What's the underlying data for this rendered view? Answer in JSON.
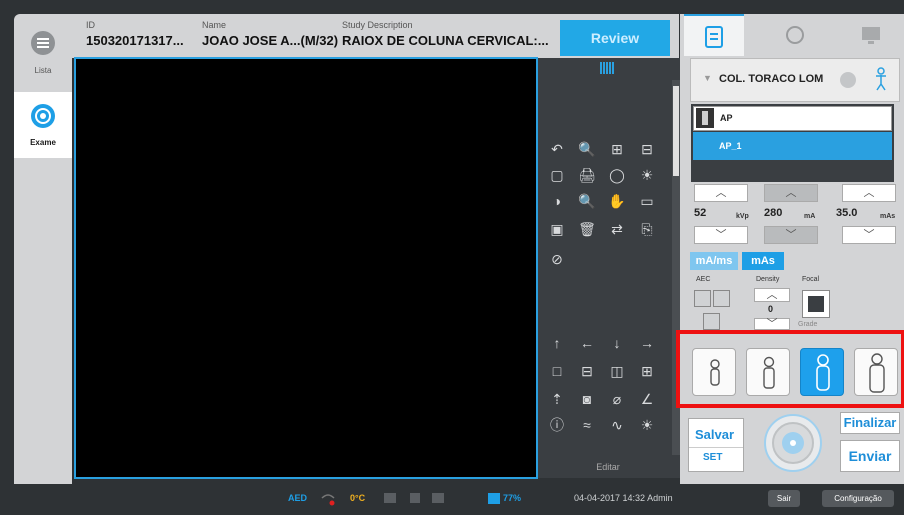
{
  "nav": {
    "items": [
      {
        "label": "Lista",
        "icon": "list-icon"
      },
      {
        "label": "Exame",
        "icon": "target-icon"
      }
    ]
  },
  "header": {
    "id_label": "ID",
    "id_value": "150320171317...",
    "name_label": "Name",
    "name_value": "JOAO JOSE A...(M/32)",
    "study_label": "Study Description",
    "study_value": "RAIOX DE COLUNA CERVICAL:...",
    "review_label": "Review"
  },
  "tools": {
    "edit_label": "Editar",
    "glyphs": [
      "↶",
      "🔍",
      "⊞",
      "⊟",
      "▢",
      "🖨",
      "◯",
      "☀",
      "◑",
      "🔍",
      "✋",
      "▭",
      "▣",
      "🗑",
      "⇄",
      "⎘",
      "⊘",
      "↑",
      "←",
      "↓",
      "→",
      "□",
      "⊟",
      "◫",
      "⊞",
      "⇡",
      "◙",
      "⌀",
      "∠",
      "ⓘ",
      "≈",
      "∿",
      "☀"
    ]
  },
  "protocol": {
    "name": "COL. TORACO LOM",
    "views": [
      {
        "label": "AP"
      },
      {
        "label": "AP_1"
      }
    ]
  },
  "params": {
    "kvp_value": "52",
    "kvp_unit": "kVp",
    "ma_value": "280",
    "ma_unit": "mA",
    "mas_value": "35.0",
    "mas_unit": "mAs",
    "mode_mams_label": "mA/ms",
    "mode_mas_label": "mAs",
    "aec_label": "AEC",
    "density_label": "Density",
    "density_value": "0",
    "focal_label": "Focal",
    "grade_label": "Grade"
  },
  "actions": {
    "salvar_label": "Salvar",
    "set_label": "SET",
    "finalizar_label": "Finalizar",
    "enviar_label": "Enviar"
  },
  "status": {
    "aed_label": "AED",
    "temp_label": "0°C",
    "battery_label": "77%",
    "datetime_user": "04-04-2017 14:32 Admin",
    "sair_label": "Sair",
    "config_label": "Configuração"
  },
  "colors": {
    "accent": "#2aa0e0",
    "highlight": "#ee1111"
  }
}
